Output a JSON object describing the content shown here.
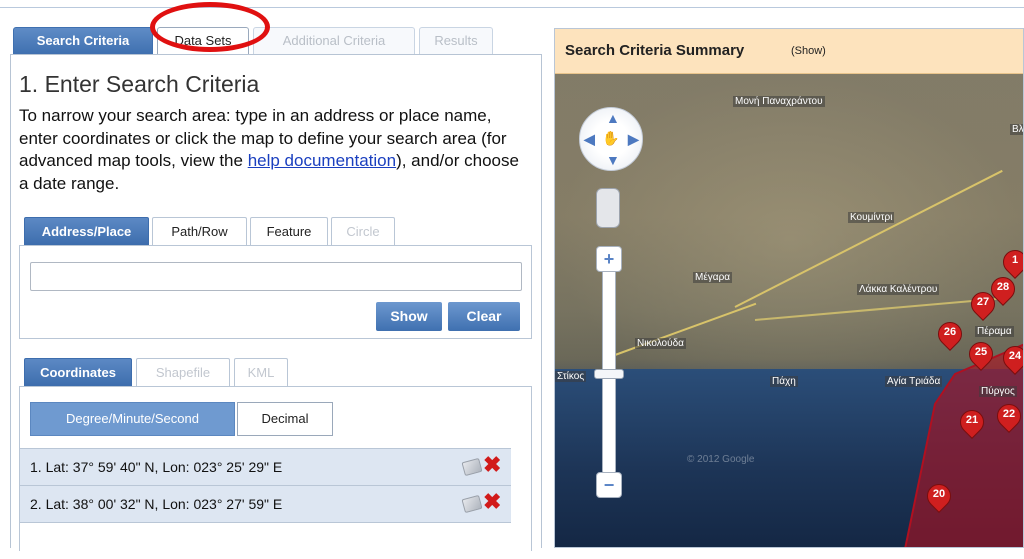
{
  "main_tabs": [
    {
      "label": "Search Criteria",
      "state": "active"
    },
    {
      "label": "Data Sets",
      "state": "normal"
    },
    {
      "label": "Additional Criteria",
      "state": "disabled"
    },
    {
      "label": "Results",
      "state": "disabled"
    }
  ],
  "heading": "1. Enter Search Criteria",
  "intro": {
    "before_link": "To narrow your search area: type in an address or place name, enter coordinates or click the map to define your search area (for advanced map tools, view the ",
    "link": "help documentation",
    "after_link": "), and/or choose a date range."
  },
  "location_tabs": [
    {
      "label": "Address/Place",
      "state": "active"
    },
    {
      "label": "Path/Row",
      "state": "normal"
    },
    {
      "label": "Feature",
      "state": "normal"
    },
    {
      "label": "Circle",
      "state": "disabled"
    }
  ],
  "address": {
    "value": "",
    "show_label": "Show",
    "clear_label": "Clear"
  },
  "coord_tabs": [
    {
      "label": "Coordinates",
      "state": "active"
    },
    {
      "label": "Shapefile",
      "state": "disabled"
    },
    {
      "label": "KML",
      "state": "disabled"
    }
  ],
  "format_toggle": {
    "dms_label": "Degree/Minute/Second",
    "decimal_label": "Decimal",
    "selected": "dms"
  },
  "coordinates": [
    {
      "label": "1. Lat: 37° 59' 40\" N, Lon: 023° 25' 29\" E"
    },
    {
      "label": "2. Lat: 38° 00' 32\" N, Lon: 023° 27' 59\" E"
    }
  ],
  "summary": {
    "title": "Search Criteria Summary",
    "toggle": "(Show)"
  },
  "map": {
    "labels": [
      "Μονή Παναχράντου",
      "Κουμίντρι",
      "Μέγαρα",
      "Λάκκα Καλέντρου",
      "Νικολούδα",
      "Πάχη",
      "Αγία Τριάδα",
      "Πύργος",
      "Πέραμα",
      "Στίκος",
      "© 2012 Google",
      "Βλ"
    ],
    "markers": [
      "1",
      "20",
      "21",
      "22",
      "24",
      "25",
      "26",
      "27",
      "28"
    ],
    "polygon_color": "#b01020"
  },
  "colors": {
    "accent": "#3f70b0",
    "summary_bg": "#fde3bd",
    "delete": "#d11a1a",
    "highlight_circle": "#e01010"
  }
}
